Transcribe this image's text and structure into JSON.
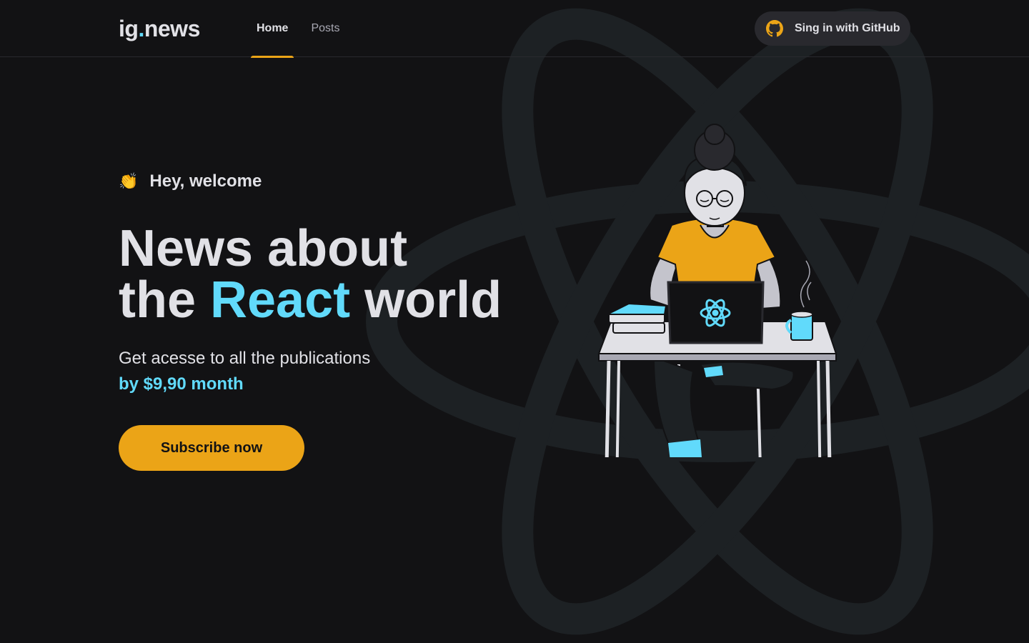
{
  "header": {
    "logo_text": "ig",
    "logo_dot": ".",
    "logo_suffix": "news",
    "nav": [
      {
        "label": "Home",
        "active": true
      },
      {
        "label": "Posts",
        "active": false
      }
    ],
    "signin_label": "Sing in with GitHub",
    "signin_icon": "github-icon"
  },
  "hero": {
    "welcome_emoji": "👏",
    "welcome_text": "Hey, welcome",
    "headline_line1": "News about",
    "headline_the": "the",
    "headline_accent": "React",
    "headline_world": "world",
    "subtitle": "Get acesse to all the publications",
    "price_text": "by $9,90 month",
    "cta_label": "Subscribe now"
  },
  "colors": {
    "background": "#121214",
    "accent_yellow": "#eba417",
    "accent_cyan": "#61dafb",
    "text": "#e1e1e6",
    "muted": "#a8a8b3"
  }
}
